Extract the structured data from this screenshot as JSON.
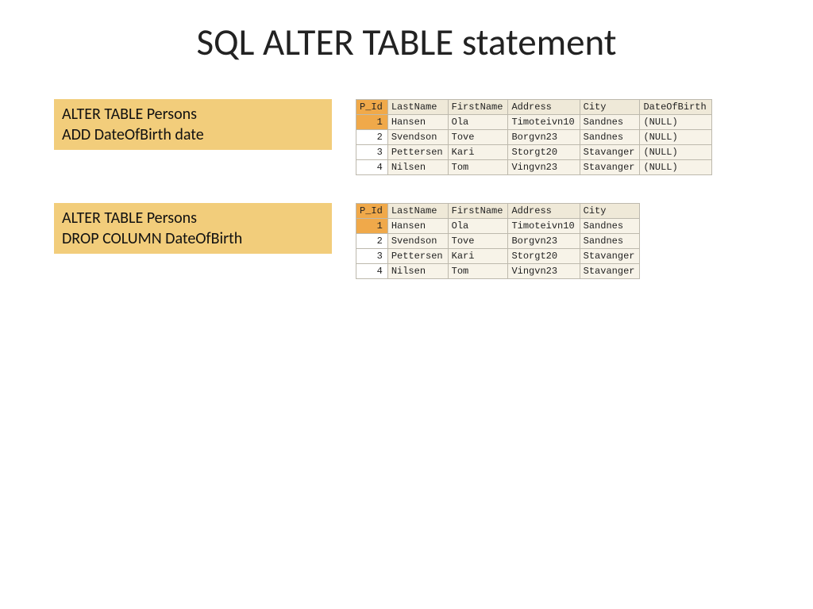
{
  "title": "SQL ALTER TABLE statement",
  "codebox1": "ALTER TABLE Persons\nADD DateOfBirth date",
  "codebox2": "ALTER TABLE Persons\nDROP COLUMN DateOfBirth",
  "table1": {
    "headers": [
      "P_Id",
      "LastName",
      "FirstName",
      "Address",
      "City",
      "DateOfBirth"
    ],
    "rows": [
      [
        "1",
        "Hansen",
        "Ola",
        "Timoteivn10",
        "Sandnes",
        "(NULL)"
      ],
      [
        "2",
        "Svendson",
        "Tove",
        "Borgvn23",
        "Sandnes",
        "(NULL)"
      ],
      [
        "3",
        "Pettersen",
        "Kari",
        "Storgt20",
        "Stavanger",
        "(NULL)"
      ],
      [
        "4",
        "Nilsen",
        "Tom",
        "Vingvn23",
        "Stavanger",
        "(NULL)"
      ]
    ]
  },
  "table2": {
    "headers": [
      "P_Id",
      "LastName",
      "FirstName",
      "Address",
      "City"
    ],
    "rows": [
      [
        "1",
        "Hansen",
        "Ola",
        "Timoteivn10",
        "Sandnes"
      ],
      [
        "2",
        "Svendson",
        "Tove",
        "Borgvn23",
        "Sandnes"
      ],
      [
        "3",
        "Pettersen",
        "Kari",
        "Storgt20",
        "Stavanger"
      ],
      [
        "4",
        "Nilsen",
        "Tom",
        "Vingvn23",
        "Stavanger"
      ]
    ]
  },
  "chart_data": [
    {
      "type": "table",
      "title": "Persons (after ADD DateOfBirth)",
      "columns": [
        "P_Id",
        "LastName",
        "FirstName",
        "Address",
        "City",
        "DateOfBirth"
      ],
      "rows": [
        [
          1,
          "Hansen",
          "Ola",
          "Timoteivn10",
          "Sandnes",
          null
        ],
        [
          2,
          "Svendson",
          "Tove",
          "Borgvn23",
          "Sandnes",
          null
        ],
        [
          3,
          "Pettersen",
          "Kari",
          "Storgt20",
          "Stavanger",
          null
        ],
        [
          4,
          "Nilsen",
          "Tom",
          "Vingvn23",
          "Stavanger",
          null
        ]
      ]
    },
    {
      "type": "table",
      "title": "Persons (after DROP COLUMN DateOfBirth)",
      "columns": [
        "P_Id",
        "LastName",
        "FirstName",
        "Address",
        "City"
      ],
      "rows": [
        [
          1,
          "Hansen",
          "Ola",
          "Timoteivn10",
          "Sandnes"
        ],
        [
          2,
          "Svendson",
          "Tove",
          "Borgvn23",
          "Sandnes"
        ],
        [
          3,
          "Pettersen",
          "Kari",
          "Storgt20",
          "Stavanger"
        ],
        [
          4,
          "Nilsen",
          "Tom",
          "Vingvn23",
          "Stavanger"
        ]
      ]
    }
  ]
}
